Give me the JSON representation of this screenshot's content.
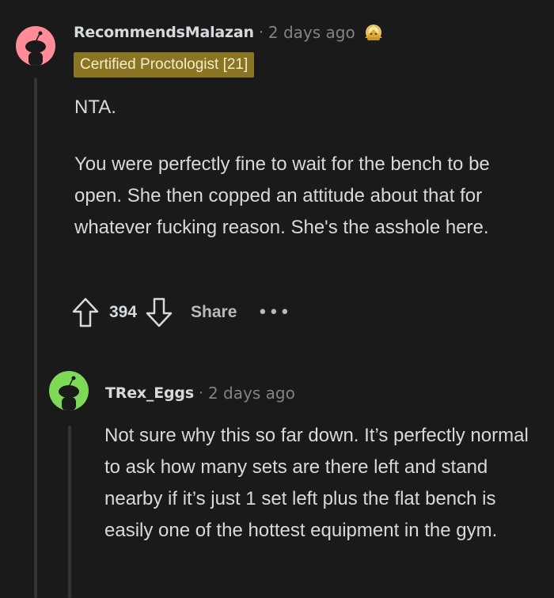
{
  "comments": [
    {
      "username": "RecommendsMalazan",
      "time": "2 days ago",
      "award_icon": "gold-award-icon",
      "flair": "Certified Proctologist [21]",
      "body": [
        "NTA.",
        "You were perfectly fine to wait for the bench to be open. She then copped an attitude about that for whatever fucking reason. She's the asshole here."
      ],
      "score": "394",
      "share_label": "Share",
      "more_label": "•••",
      "avatar_color": "#ff8c97"
    },
    {
      "username": "TRex_Eggs",
      "time": "2 days ago",
      "body": [
        "Not sure why this so far down. It’s perfectly normal to ask how many sets are there left and stand nearby if it’s just 1 set left plus the flat bench is easily one of the hottest equipment in the gym."
      ],
      "avatar_color": "#7ed957"
    }
  ],
  "separator": "·",
  "colors": {
    "background": "#1a1a1b",
    "text": "#d7dadc",
    "meta": "#818384",
    "flair_bg": "#8b7422"
  }
}
